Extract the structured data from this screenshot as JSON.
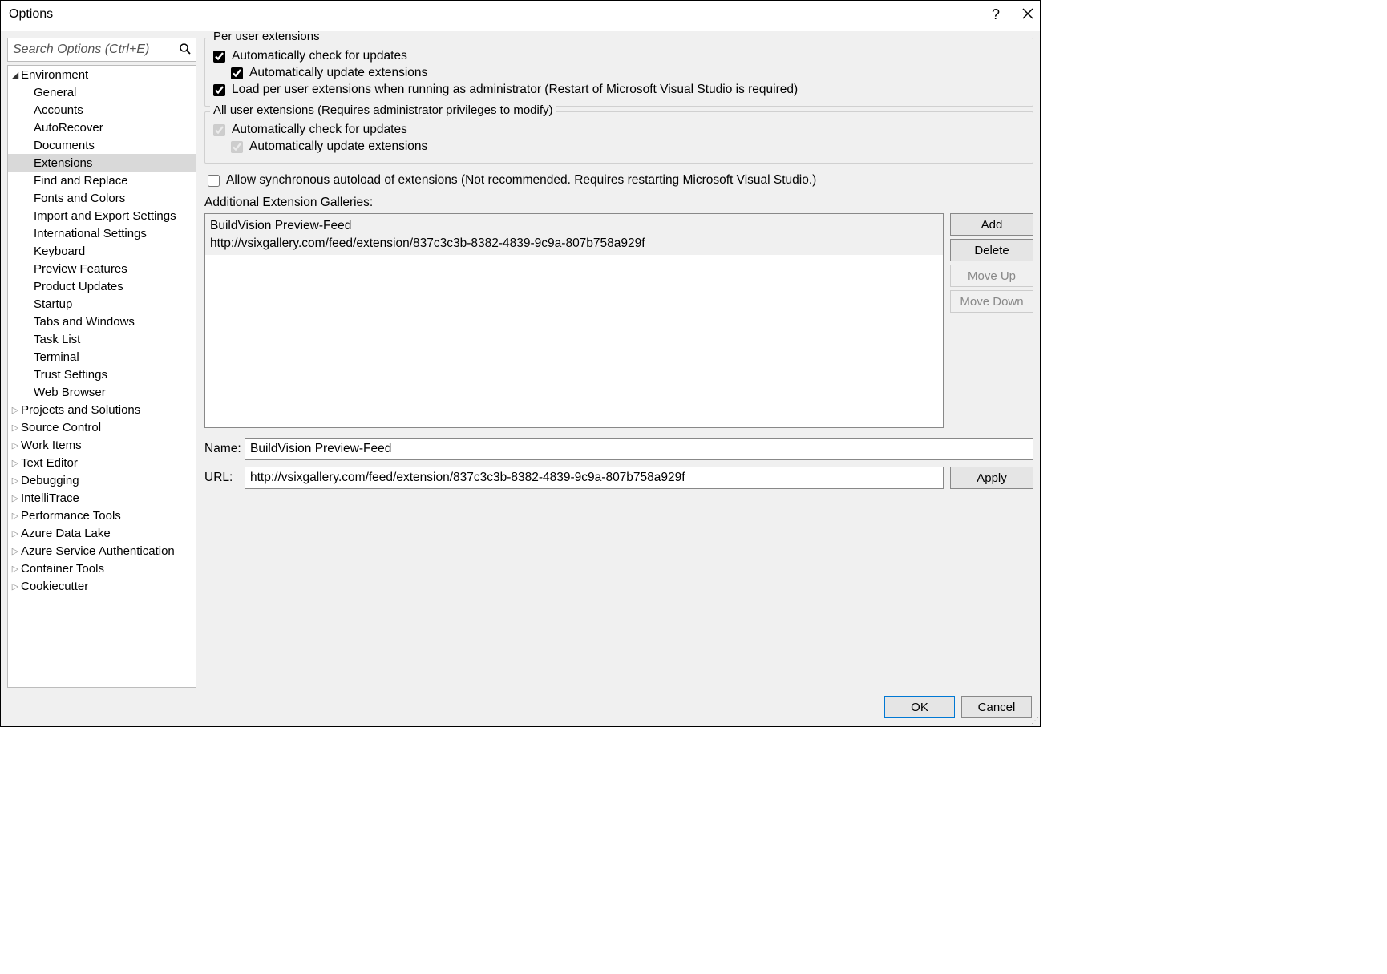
{
  "window": {
    "title": "Options"
  },
  "search": {
    "placeholder": "Search Options (Ctrl+E)"
  },
  "tree": {
    "top": [
      {
        "label": "Environment",
        "expanded": true,
        "children": [
          "General",
          "Accounts",
          "AutoRecover",
          "Documents",
          "Extensions",
          "Find and Replace",
          "Fonts and Colors",
          "Import and Export Settings",
          "International Settings",
          "Keyboard",
          "Preview Features",
          "Product Updates",
          "Startup",
          "Tabs and Windows",
          "Task List",
          "Terminal",
          "Trust Settings",
          "Web Browser"
        ],
        "selected": "Extensions"
      },
      {
        "label": "Projects and Solutions",
        "expanded": false
      },
      {
        "label": "Source Control",
        "expanded": false
      },
      {
        "label": "Work Items",
        "expanded": false
      },
      {
        "label": "Text Editor",
        "expanded": false
      },
      {
        "label": "Debugging",
        "expanded": false
      },
      {
        "label": "IntelliTrace",
        "expanded": false
      },
      {
        "label": "Performance Tools",
        "expanded": false
      },
      {
        "label": "Azure Data Lake",
        "expanded": false
      },
      {
        "label": "Azure Service Authentication",
        "expanded": false
      },
      {
        "label": "Container Tools",
        "expanded": false
      },
      {
        "label": "Cookiecutter",
        "expanded": false
      }
    ]
  },
  "per_user": {
    "title": "Per user extensions",
    "auto_check": {
      "label": "Automatically check for updates",
      "checked": true
    },
    "auto_update": {
      "label": "Automatically update extensions",
      "checked": true
    },
    "load_admin": {
      "label": "Load per user extensions when running as administrator (Restart of Microsoft Visual Studio is required)",
      "checked": true
    }
  },
  "all_user": {
    "title": "All user extensions (Requires administrator privileges to modify)",
    "auto_check": {
      "label": "Automatically check for updates",
      "checked": true
    },
    "auto_update": {
      "label": "Automatically update extensions",
      "checked": true
    }
  },
  "allow_sync": {
    "label": "Allow synchronous autoload of extensions (Not recommended. Requires restarting Microsoft Visual Studio.)",
    "checked": false
  },
  "galleries": {
    "label": "Additional Extension Galleries:",
    "items": [
      {
        "name": "BuildVision Preview-Feed",
        "url": "http://vsixgallery.com/feed/extension/837c3c3b-8382-4839-9c9a-807b758a929f"
      }
    ],
    "buttons": {
      "add": "Add",
      "delete": "Delete",
      "move_up": "Move Up",
      "move_down": "Move Down"
    }
  },
  "fields": {
    "name_label": "Name:",
    "name_value": "BuildVision Preview-Feed",
    "url_label": "URL:",
    "url_value": "http://vsixgallery.com/feed/extension/837c3c3b-8382-4839-9c9a-807b758a929f",
    "apply": "Apply"
  },
  "footer": {
    "ok": "OK",
    "cancel": "Cancel"
  }
}
